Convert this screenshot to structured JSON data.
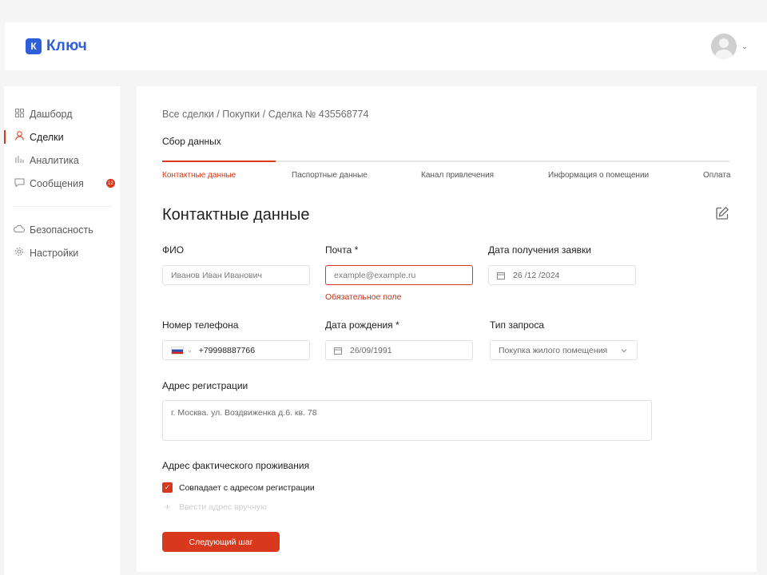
{
  "app": {
    "logo_letter": "К",
    "logo_text": "Ключ"
  },
  "header": {
    "avatar_icon": "user-avatar",
    "menu_chevron": "⌄"
  },
  "sidebar": {
    "items": [
      {
        "label": "Дашборд",
        "icon": "grid-icon"
      },
      {
        "label": "Сделки",
        "icon": "user-icon",
        "active": true
      },
      {
        "label": "Аналитика",
        "icon": "bar-chart-icon"
      },
      {
        "label": "Сообщения",
        "icon": "message-icon",
        "badge": "12"
      }
    ],
    "secondary": [
      {
        "label": "Безопасность",
        "icon": "cloud-icon"
      },
      {
        "label": "Настройки",
        "icon": "gear-icon"
      }
    ]
  },
  "breadcrumb": "Все сделки / Покупки / Сделка № 435568774",
  "section_tab": "Сбор данных",
  "steps": [
    {
      "label": "Контактные данные",
      "active": true
    },
    {
      "label": "Паспортные данные"
    },
    {
      "label": "Канал привлечения"
    },
    {
      "label": "Информация о помещении"
    },
    {
      "label": "Оплата"
    }
  ],
  "form": {
    "title": "Контактные данные",
    "fio": {
      "label": "ФИО",
      "placeholder": "Иванов Иван Иванович"
    },
    "email": {
      "label": "Почта *",
      "placeholder": "example@example.ru",
      "error": "Обязательное поле"
    },
    "request_date": {
      "label": "Дата получения заявки",
      "value": "26 /12 /2024"
    },
    "phone": {
      "label": "Номер телефона",
      "value": "+79998887766"
    },
    "birth_date": {
      "label": "Дата рождения *",
      "value": "26/09/1991"
    },
    "request_type": {
      "label": "Тип запроса",
      "value": "Покупка жилого помещения"
    },
    "reg_address": {
      "label": "Адрес регистрации",
      "value": "г. Москва. ул. Воздвиженка д.6. кв. 78"
    },
    "actual_address": {
      "label": "Адрес фактического проживания",
      "checkbox_label": "Совпадает с адресом регистрации",
      "checked": true,
      "manual_label": "Ввести адрес вручную"
    },
    "next_button": "Следующий шаг"
  },
  "colors": {
    "accent": "#d8391c",
    "brand": "#2f5fd8"
  }
}
